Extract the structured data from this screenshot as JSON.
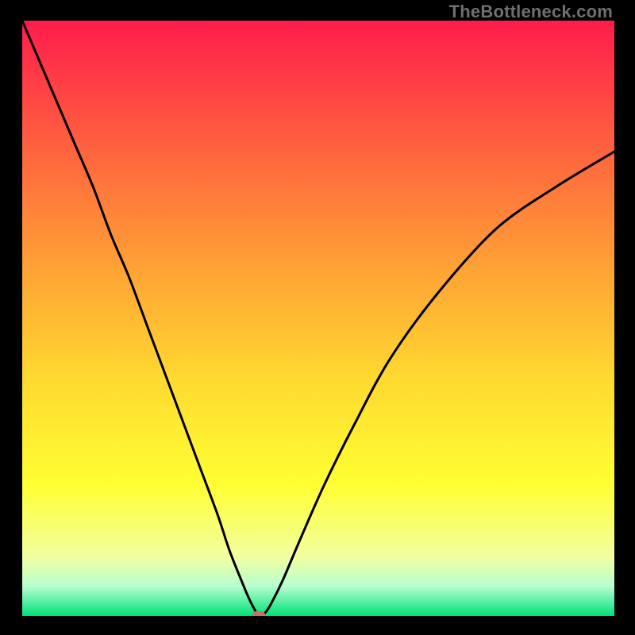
{
  "watermark": {
    "text": "TheBottleneck.com"
  },
  "colors": {
    "top": "#ff1c4b",
    "mid1": "#ff643e",
    "mid2": "#ffa335",
    "mid3": "#ffd930",
    "mid4": "#ffff33",
    "mid5": "#f3ffa0",
    "mid6": "#b8ffd0",
    "bottom": "#00e077",
    "curve": "#000000",
    "marker": "#c77168",
    "frame": "#000000"
  },
  "chart_data": {
    "type": "line",
    "title": "",
    "xlabel": "",
    "ylabel": "",
    "xlim": [
      0,
      100
    ],
    "ylim": [
      0,
      100
    ],
    "series": [
      {
        "name": "bottleneck-curve",
        "x": [
          0,
          3,
          6,
          9,
          12,
          15,
          18,
          21,
          24,
          27,
          30,
          33,
          35,
          37,
          38.5,
          40,
          41,
          42,
          44,
          47,
          51,
          56,
          62,
          70,
          80,
          90,
          100
        ],
        "values": [
          100,
          93,
          86,
          79,
          72,
          64,
          57,
          49,
          41,
          33,
          25,
          17,
          11,
          6,
          2.5,
          0,
          0.5,
          2,
          6,
          13,
          22,
          32,
          43,
          54,
          65,
          72,
          78
        ]
      }
    ],
    "marker": {
      "x": 40,
      "y": 0
    },
    "gradient_stops": [
      {
        "offset": 0.0,
        "color": "#ff1c4b"
      },
      {
        "offset": 0.22,
        "color": "#ff643e"
      },
      {
        "offset": 0.42,
        "color": "#ffa335"
      },
      {
        "offset": 0.6,
        "color": "#ffd930"
      },
      {
        "offset": 0.78,
        "color": "#ffff33"
      },
      {
        "offset": 0.9,
        "color": "#f3ffa0"
      },
      {
        "offset": 0.95,
        "color": "#b8ffd0"
      },
      {
        "offset": 1.0,
        "color": "#00e077"
      }
    ]
  }
}
